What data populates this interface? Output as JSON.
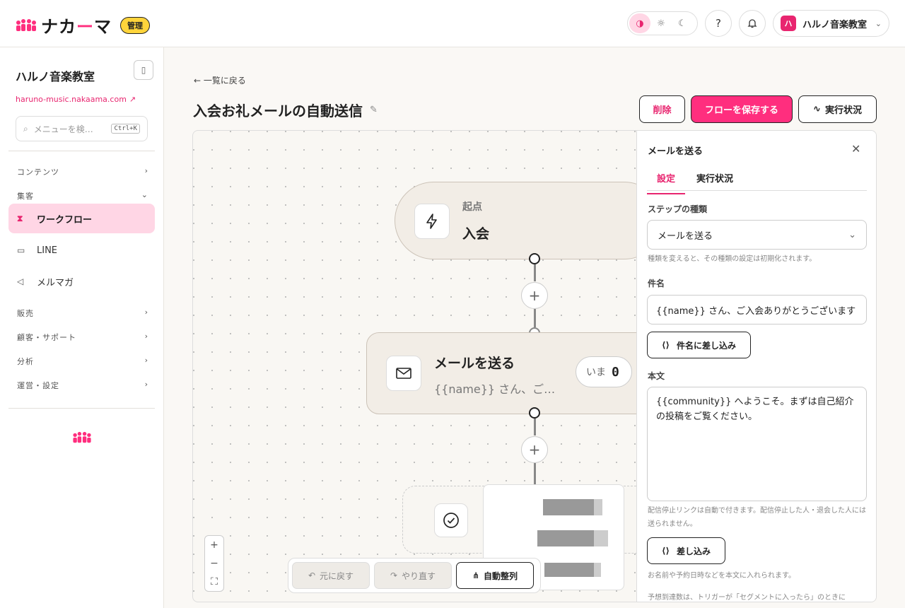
{
  "header": {
    "brand_prefix": "ナカ",
    "brand_dash": "ー",
    "brand_suffix": "マ",
    "admin_badge": "管理",
    "user_initial": "ハ",
    "user_name": "ハルノ音楽教室"
  },
  "sidebar": {
    "org_name": "ハルノ音楽教室",
    "site_url": "haruno-music.nakaama.com",
    "search_placeholder": "メニューを検…",
    "search_shortcut": "Ctrl+K",
    "sections": {
      "contents": "コンテンツ",
      "acquisition": "集客",
      "sales": "販売",
      "customers": "顧客・サポート",
      "analytics": "分析",
      "operations": "運営・設定"
    },
    "items": {
      "workflow": "ワークフロー",
      "line": "LINE",
      "newsletter": "メルマガ"
    }
  },
  "main": {
    "back_label": "一覧に戻る",
    "title": "入会お礼メールの自動送信",
    "delete_label": "削除",
    "save_label": "フローを保存する",
    "status_label": "実行状況"
  },
  "canvas": {
    "start_node": {
      "sub": "起点",
      "title": "入会"
    },
    "mail_node": {
      "title": "メールを送る",
      "desc": "{{name}} さん、ご…",
      "now_label": "いま",
      "now_count": "0"
    },
    "undo_label": "元に戻す",
    "redo_label": "やり直す",
    "auto_layout_label": "自動整列"
  },
  "panel": {
    "title": "メールを送る",
    "tabs": [
      "設定",
      "実行状況"
    ],
    "step_type_label": "ステップの種類",
    "step_type_value": "メールを送る",
    "step_type_hint": "種類を変えると、その種類の設定は初期化されます。",
    "subject_label": "件名",
    "subject_value": "{{name}} さん、ご入会ありがとうございます",
    "subject_insert_label": "件名に差し込み",
    "body_label": "本文",
    "body_value": "{{community}} へようこそ。まずは自己紹介の投稿をご覧ください。",
    "body_hint": "配信停止リンクは自動で付きます。配信停止した人・退会した人には送られません。",
    "insert_label": "差し込み",
    "insert_hint": "お名前や予約日時などを本文に入れられます。",
    "footer_hint": "予想到達数は、トリガーが「セグメントに入ったら」のときに"
  },
  "colors": {
    "accent": "#ff2e7e",
    "accent_bg": "#ffd6e5",
    "badge": "#ffd43b"
  }
}
